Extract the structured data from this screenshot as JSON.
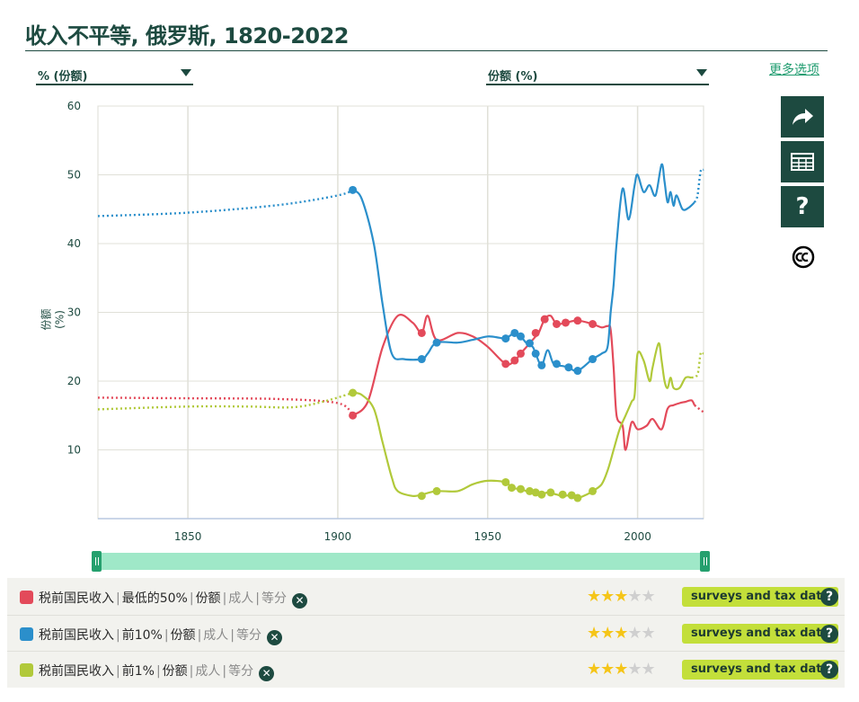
{
  "page": {
    "title": "收入不平等, 俄罗斯, 1820-2022",
    "more_options": "更多选项"
  },
  "controls": {
    "left_dropdown": "% (份额)",
    "right_dropdown": "份额 (%)"
  },
  "side_buttons": [
    "share-icon",
    "table-icon",
    "help-icon",
    "cc-license-icon"
  ],
  "side_help_glyph": "?",
  "chart_data": {
    "type": "line",
    "title": "收入不平等, 俄罗斯, 1820-2022",
    "xlabel": "",
    "ylabel": "份额(%)",
    "xlim": [
      1820,
      2022
    ],
    "ylim": [
      0,
      60
    ],
    "x_ticks": [
      1850,
      1900,
      1950,
      2000
    ],
    "y_ticks": [
      10,
      20,
      30,
      40,
      50,
      60
    ],
    "grid": true,
    "series": [
      {
        "name": "税前国民收入 | 最低的50% | 份额",
        "color": "#e34a5a",
        "interpolated": [
          [
            1820,
            17.6
          ],
          [
            1850,
            17.5
          ],
          [
            1880,
            17.4
          ],
          [
            1900,
            16.8
          ],
          [
            1905,
            15.0
          ]
        ],
        "measured": [
          [
            1905,
            15.0
          ],
          [
            1910,
            17.0
          ],
          [
            1915,
            25.0
          ],
          [
            1920,
            29.5
          ],
          [
            1925,
            28.5
          ],
          [
            1928,
            27.0
          ],
          [
            1930,
            29.5
          ],
          [
            1933,
            26.0
          ],
          [
            1940,
            27.0
          ],
          [
            1945,
            26.5
          ],
          [
            1950,
            25.0
          ],
          [
            1956,
            22.5
          ],
          [
            1959,
            23.0
          ],
          [
            1961,
            24.0
          ],
          [
            1963,
            25.0
          ],
          [
            1966,
            26.5
          ],
          [
            1967,
            27.0
          ],
          [
            1969,
            29.0
          ],
          [
            1971,
            29.5
          ],
          [
            1973,
            28.3
          ],
          [
            1976,
            28.5
          ],
          [
            1980,
            28.8
          ],
          [
            1985,
            28.3
          ],
          [
            1988,
            27.8
          ],
          [
            1990,
            28.0
          ],
          [
            1991,
            27.5
          ],
          [
            1992,
            22.0
          ],
          [
            1993,
            15.0
          ],
          [
            1995,
            13.5
          ],
          [
            1996,
            10.0
          ],
          [
            1998,
            14.0
          ],
          [
            2000,
            13.0
          ],
          [
            2003,
            13.5
          ],
          [
            2005,
            14.5
          ],
          [
            2008,
            13.0
          ],
          [
            2010,
            16.0
          ],
          [
            2012,
            16.5
          ],
          [
            2014,
            16.8
          ],
          [
            2016,
            17.0
          ],
          [
            2018,
            17.2
          ],
          [
            2019,
            16.5
          ]
        ],
        "projected": [
          [
            2019,
            16.5
          ],
          [
            2021,
            15.8
          ],
          [
            2022,
            15.5
          ]
        ],
        "markers": [
          [
            1905,
            15.0
          ],
          [
            1928,
            27.0
          ],
          [
            1956,
            22.5
          ],
          [
            1959,
            23.0
          ],
          [
            1961,
            24.0
          ],
          [
            1966,
            27.0
          ],
          [
            1969,
            29.0
          ],
          [
            1973,
            28.3
          ],
          [
            1976,
            28.5
          ],
          [
            1980,
            28.8
          ],
          [
            1985,
            28.3
          ]
        ]
      },
      {
        "name": "税前国民收入 | 前10% | 份额",
        "color": "#2b8fcb",
        "interpolated": [
          [
            1820,
            44.0
          ],
          [
            1850,
            44.5
          ],
          [
            1880,
            45.6
          ],
          [
            1900,
            47.0
          ],
          [
            1905,
            47.8
          ]
        ],
        "measured": [
          [
            1905,
            47.8
          ],
          [
            1908,
            46.5
          ],
          [
            1912,
            40.0
          ],
          [
            1915,
            31.0
          ],
          [
            1918,
            24.0
          ],
          [
            1922,
            23.2
          ],
          [
            1928,
            23.2
          ],
          [
            1930,
            24.0
          ],
          [
            1933,
            25.6
          ],
          [
            1940,
            25.6
          ],
          [
            1945,
            26.0
          ],
          [
            1950,
            26.5
          ],
          [
            1954,
            26.3
          ],
          [
            1956,
            26.2
          ],
          [
            1959,
            27.0
          ],
          [
            1961,
            26.5
          ],
          [
            1963,
            25.5
          ],
          [
            1965,
            25.0
          ],
          [
            1966,
            24.0
          ],
          [
            1968,
            22.3
          ],
          [
            1970,
            24.5
          ],
          [
            1972,
            22.5
          ],
          [
            1975,
            22.2
          ],
          [
            1977,
            22.0
          ],
          [
            1980,
            21.5
          ],
          [
            1985,
            23.2
          ],
          [
            1988,
            24.0
          ],
          [
            1990,
            25.0
          ],
          [
            1991,
            30.0
          ],
          [
            1992,
            34.0
          ],
          [
            1993,
            40.0
          ],
          [
            1995,
            48.0
          ],
          [
            1997,
            43.5
          ],
          [
            1999,
            48.5
          ],
          [
            2000,
            50.0
          ],
          [
            2002,
            47.5
          ],
          [
            2004,
            48.5
          ],
          [
            2006,
            47.0
          ],
          [
            2008,
            51.5
          ],
          [
            2009,
            49.0
          ],
          [
            2010,
            46.0
          ],
          [
            2011,
            47.5
          ],
          [
            2012,
            45.5
          ],
          [
            2013,
            47.0
          ],
          [
            2015,
            45.0
          ],
          [
            2017,
            45.2
          ],
          [
            2019,
            46.0
          ]
        ],
        "projected": [
          [
            2019,
            46.0
          ],
          [
            2020,
            47.0
          ],
          [
            2021,
            50.5
          ],
          [
            2022,
            50.8
          ]
        ],
        "markers": [
          [
            1905,
            47.8
          ],
          [
            1928,
            23.2
          ],
          [
            1933,
            25.6
          ],
          [
            1956,
            26.2
          ],
          [
            1959,
            27.0
          ],
          [
            1961,
            26.5
          ],
          [
            1964,
            25.5
          ],
          [
            1966,
            24.0
          ],
          [
            1968,
            22.3
          ],
          [
            1973,
            22.5
          ],
          [
            1977,
            22.0
          ],
          [
            1980,
            21.5
          ],
          [
            1985,
            23.2
          ]
        ]
      },
      {
        "name": "税前国民收入 | 前1% | 份额",
        "color": "#b1c93a",
        "interpolated": [
          [
            1820,
            15.9
          ],
          [
            1850,
            16.3
          ],
          [
            1870,
            16.3
          ],
          [
            1885,
            16.2
          ],
          [
            1895,
            17.0
          ],
          [
            1905,
            18.3
          ]
        ],
        "measured": [
          [
            1905,
            18.3
          ],
          [
            1908,
            18.0
          ],
          [
            1912,
            16.0
          ],
          [
            1915,
            11.0
          ],
          [
            1918,
            6.0
          ],
          [
            1920,
            4.0
          ],
          [
            1925,
            3.3
          ],
          [
            1928,
            3.5
          ],
          [
            1933,
            4.0
          ],
          [
            1940,
            4.0
          ],
          [
            1945,
            5.0
          ],
          [
            1950,
            5.5
          ],
          [
            1956,
            5.3
          ],
          [
            1958,
            4.5
          ],
          [
            1961,
            4.3
          ],
          [
            1963,
            4.0
          ],
          [
            1966,
            3.8
          ],
          [
            1968,
            3.5
          ],
          [
            1970,
            3.8
          ],
          [
            1973,
            3.5
          ],
          [
            1975,
            3.3
          ],
          [
            1978,
            3.4
          ],
          [
            1980,
            3.0
          ],
          [
            1983,
            3.5
          ],
          [
            1985,
            4.0
          ],
          [
            1988,
            5.0
          ],
          [
            1990,
            7.0
          ],
          [
            1992,
            10.0
          ],
          [
            1994,
            13.0
          ],
          [
            1996,
            15.0
          ],
          [
            1998,
            17.0
          ],
          [
            1999,
            18.0
          ],
          [
            2000,
            24.0
          ],
          [
            2002,
            23.0
          ],
          [
            2004,
            20.0
          ],
          [
            2005,
            22.0
          ],
          [
            2007,
            25.5
          ],
          [
            2008,
            23.0
          ],
          [
            2009,
            20.0
          ],
          [
            2010,
            19.0
          ],
          [
            2011,
            20.5
          ],
          [
            2012,
            19.0
          ],
          [
            2014,
            19.0
          ],
          [
            2016,
            20.5
          ],
          [
            2018,
            20.5
          ]
        ],
        "projected": [
          [
            2018,
            20.5
          ],
          [
            2020,
            21.0
          ],
          [
            2021,
            24.0
          ],
          [
            2022,
            24.0
          ]
        ],
        "markers": [
          [
            1905,
            18.3
          ],
          [
            1928,
            3.3
          ],
          [
            1933,
            4.0
          ],
          [
            1956,
            5.3
          ],
          [
            1958,
            4.5
          ],
          [
            1961,
            4.3
          ],
          [
            1964,
            4.0
          ],
          [
            1966,
            3.8
          ],
          [
            1968,
            3.5
          ],
          [
            1971,
            3.8
          ],
          [
            1975,
            3.5
          ],
          [
            1978,
            3.4
          ],
          [
            1980,
            3.0
          ],
          [
            1985,
            4.0
          ]
        ]
      }
    ]
  },
  "slider": {
    "range": [
      1820,
      2022
    ]
  },
  "legend": {
    "rows": [
      {
        "color": "#e34a5a",
        "indicator": "税前国民收入",
        "group": "最低的50%",
        "measure": "份额",
        "population": "成人",
        "unit": "等分",
        "remove_glyph": "✕",
        "stars_on": "★★★",
        "stars_off": "★★",
        "rating": 3,
        "source": "surveys and tax data",
        "help": "?"
      },
      {
        "color": "#2b8fcb",
        "indicator": "税前国民收入",
        "group": "前10%",
        "measure": "份额",
        "population": "成人",
        "unit": "等分",
        "remove_glyph": "✕",
        "stars_on": "★★★",
        "stars_off": "★★",
        "rating": 3,
        "source": "surveys and tax data",
        "help": "?"
      },
      {
        "color": "#b1c93a",
        "indicator": "税前国民收入",
        "group": "前1%",
        "measure": "份额",
        "population": "成人",
        "unit": "等分",
        "remove_glyph": "✕",
        "stars_on": "★★★",
        "stars_off": "★★",
        "rating": 3,
        "source": "surveys and tax data",
        "help": "?"
      }
    ]
  }
}
